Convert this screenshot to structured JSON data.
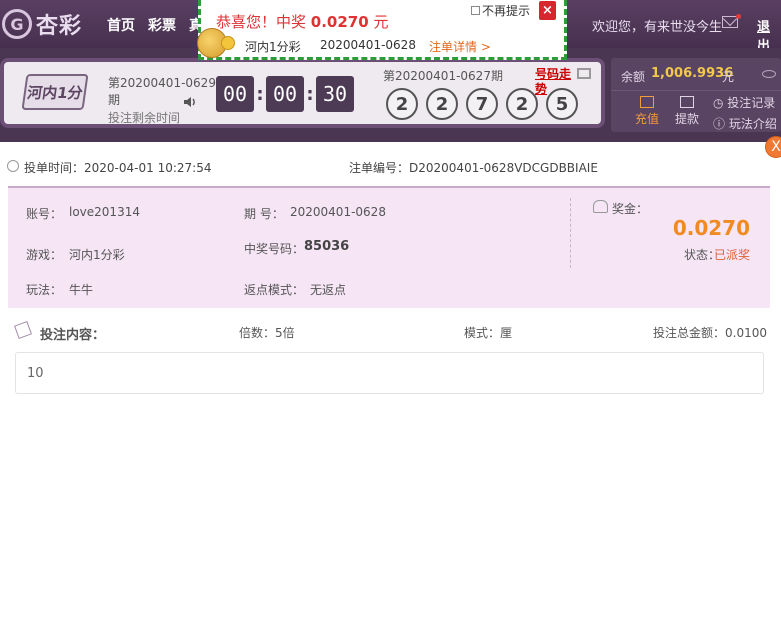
{
  "header": {
    "logo_mark": "G",
    "logo_text": "杏彩",
    "nav": [
      "首页",
      "彩票",
      "真"
    ],
    "welcome": "欢迎您，有来世没今生",
    "logout": "退出"
  },
  "lottery": {
    "game_logo": "河内1分",
    "current_issue": "第20200401-0629期",
    "remain_label": "投注剩余时间",
    "timer": [
      "00",
      "00",
      "30"
    ],
    "prev_issue": "第20200401-0627期",
    "trend_link": "号码走势",
    "balls": [
      "2",
      "2",
      "7",
      "2",
      "5"
    ]
  },
  "account": {
    "balance_label": "余额",
    "balance": "1,006.9936",
    "unit": "元",
    "deposit": "充值",
    "withdraw": "提款",
    "records": "投注记录",
    "rules": "玩法介绍"
  },
  "popup": {
    "prefix": "恭喜您！中奖 ",
    "amount": "0.0270",
    "suffix": " 元",
    "no_remind": "不再提示",
    "close": "×",
    "game": "河内1分彩",
    "issue": "20200401-0628",
    "detail_link": "注单详情 >"
  },
  "detail": {
    "close": "X",
    "bet_time_label": "投单时间：",
    "bet_time": "2020-04-01 10:27:54",
    "bet_no_label": "注单编号：",
    "bet_no": "D20200401-0628VDCGDBBIAIE",
    "account_label": "账号：",
    "account": "love201314",
    "issue_label": "期 号：",
    "issue": "20200401-0628",
    "game_label": "游戏：",
    "game": "河内1分彩",
    "winning_label": "中奖号码：",
    "winning_number": "85036",
    "play_label": "玩法：",
    "play": "牛牛",
    "rebate_label": "返点模式：",
    "rebate": "无返点",
    "prize_label": "奖金：",
    "prize": "0.0270",
    "status_label": "状态：",
    "status": "已派奖",
    "content_title": "投注内容：",
    "multiple": "倍数：5倍",
    "mode": "模式：厘",
    "total": "投注总金额：0.0100",
    "content": "10"
  }
}
